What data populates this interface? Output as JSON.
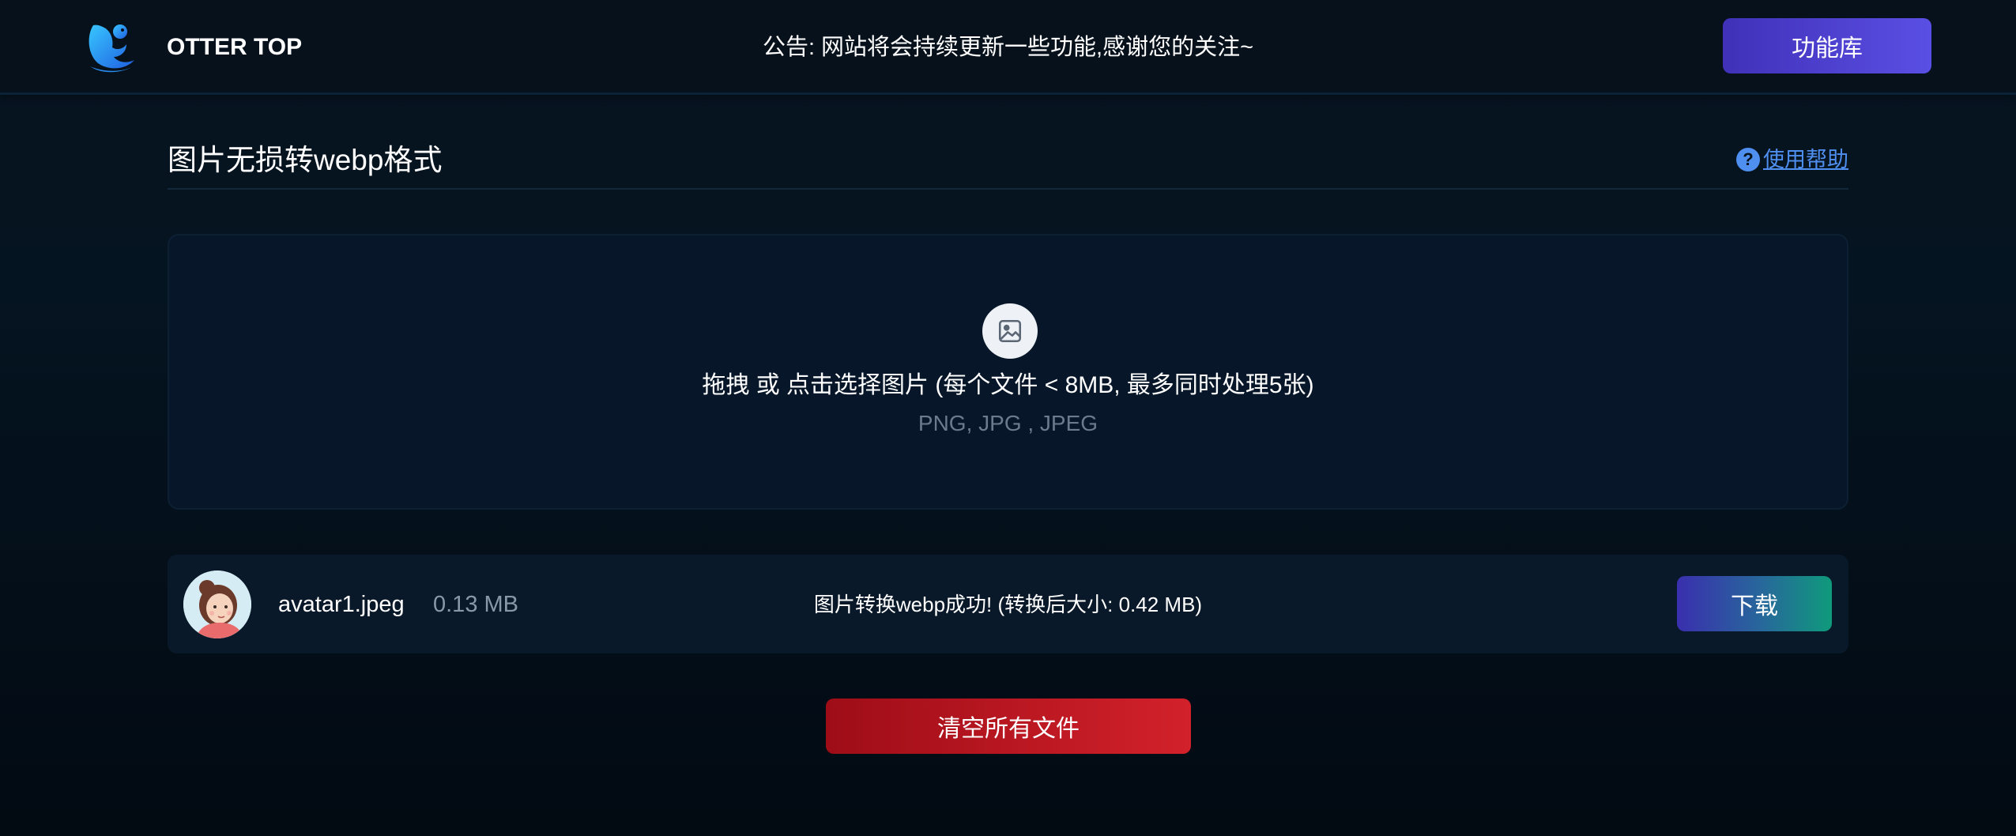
{
  "header": {
    "brand": "OTTER TOP",
    "logo_icon": "otter-logo-icon",
    "announcement": "公告: 网站将会持续更新一些功能,感谢您的关注~",
    "feature_button": "功能库"
  },
  "page": {
    "title": "图片无损转webp格式",
    "help_label": "使用帮助",
    "help_icon": "question-circle-icon"
  },
  "dropzone": {
    "icon": "image-icon",
    "primary_text": "拖拽 或 点击选择图片 (每个文件 < 8MB, 最多同时处理5张)",
    "formats": "PNG, JPG , JPEG"
  },
  "files": [
    {
      "name": "avatar1.jpeg",
      "size": "0.13 MB",
      "status": "图片转换webp成功! (转换后大小: 0.42 MB)",
      "download_label": "下载"
    }
  ],
  "actions": {
    "clear_all": "清空所有文件"
  },
  "colors": {
    "background": "#051421",
    "accent_primary": "#5a4fe4",
    "help_link": "#4f8ff0",
    "danger": "#d2212b",
    "success_gradient_end": "#0f9a7c"
  }
}
